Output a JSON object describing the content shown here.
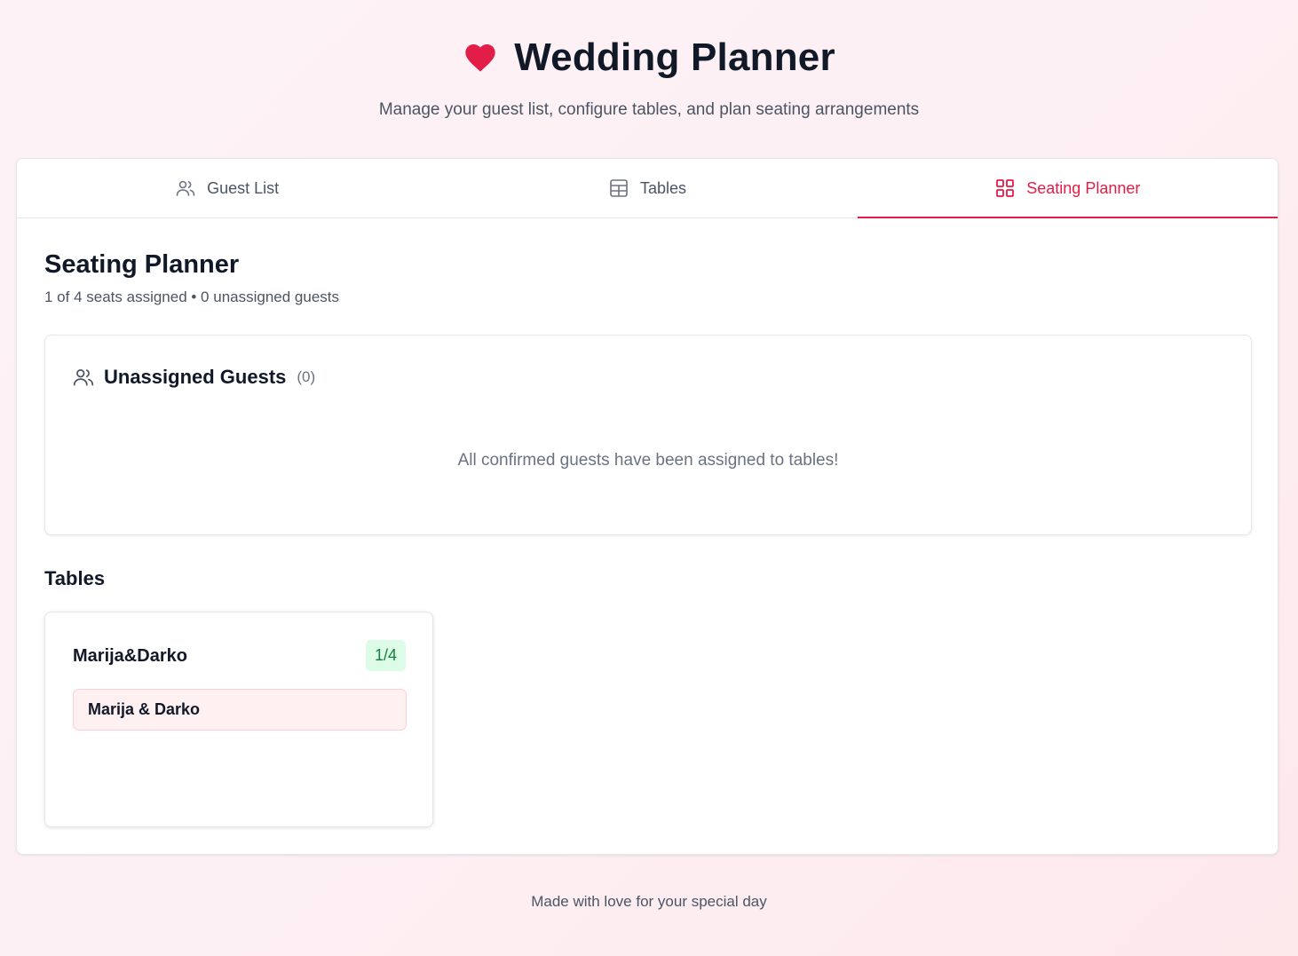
{
  "header": {
    "title": "Wedding Planner",
    "subtitle": "Manage your guest list, configure tables, and plan seating arrangements",
    "icon": "heart-icon",
    "accent_color": "#e11d48"
  },
  "tabs": [
    {
      "label": "Guest List",
      "icon": "users-icon",
      "active": false
    },
    {
      "label": "Tables",
      "icon": "table-grid-icon",
      "active": false
    },
    {
      "label": "Seating Planner",
      "icon": "layout-grid-icon",
      "active": true
    }
  ],
  "seating": {
    "title": "Seating Planner",
    "summary": "1 of 4 seats assigned • 0 unassigned guests",
    "unassigned": {
      "title": "Unassigned Guests",
      "count": "(0)",
      "empty_message": "All confirmed guests have been assigned to tables!"
    },
    "tables_title": "Tables",
    "tables": [
      {
        "name": "Marija&Darko",
        "capacity_badge": "1/4",
        "guests": [
          "Marija & Darko"
        ]
      }
    ]
  },
  "footer": {
    "text": "Made with love for your special day"
  }
}
